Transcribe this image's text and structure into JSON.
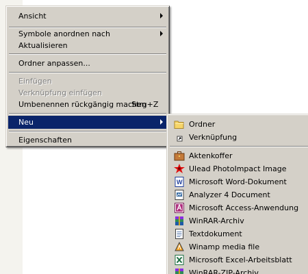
{
  "context_menu": {
    "items": [
      {
        "label": "Ansicht"
      },
      {
        "label": "Symbole anordnen nach"
      },
      {
        "label": "Aktualisieren"
      },
      {
        "label": "Ordner anpassen..."
      },
      {
        "label": "Einfügen"
      },
      {
        "label": "Verknüpfung einfügen"
      },
      {
        "label": "Umbenennen rückgängig machen",
        "shortcut": "Strg+Z"
      },
      {
        "label": "Neu"
      },
      {
        "label": "Eigenschaften"
      }
    ]
  },
  "new_submenu": {
    "items": [
      {
        "label": "Ordner",
        "icon": "folder-icon"
      },
      {
        "label": "Verknüpfung",
        "icon": "shortcut-icon"
      },
      {
        "label": "Aktenkoffer",
        "icon": "briefcase-icon"
      },
      {
        "label": "Ulead PhotoImpact Image",
        "icon": "photoimpact-icon"
      },
      {
        "label": "Microsoft Word-Dokument",
        "icon": "word-document-icon"
      },
      {
        "label": "Analyzer 4 Document",
        "icon": "analyzer-document-icon"
      },
      {
        "label": "Microsoft Access-Anwendung",
        "icon": "access-icon"
      },
      {
        "label": "WinRAR-Archiv",
        "icon": "winrar-archive-icon"
      },
      {
        "label": "Textdokument",
        "icon": "text-document-icon"
      },
      {
        "label": "Winamp media file",
        "icon": "winamp-icon"
      },
      {
        "label": "Microsoft Excel-Arbeitsblatt",
        "icon": "excel-icon"
      },
      {
        "label": "WinRAR-ZIP-Archiv",
        "icon": "winrar-zip-icon"
      }
    ]
  },
  "colors": {
    "menu_face": "#d4d0c8",
    "highlight": "#0a246a",
    "disabled_text": "#808080"
  }
}
